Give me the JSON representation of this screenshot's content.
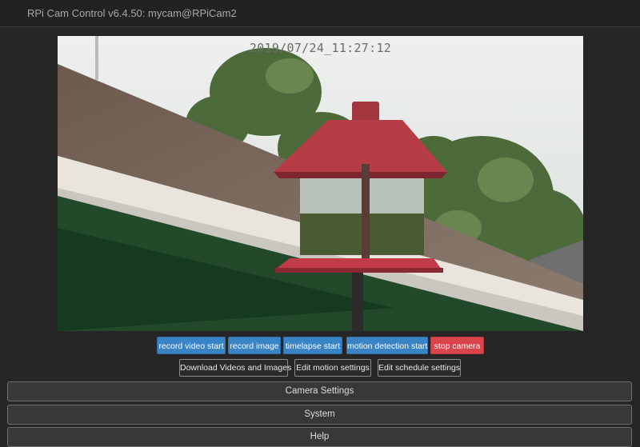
{
  "navbar": {
    "title": "RPi Cam Control v6.4.50: mycam@RPiCam2"
  },
  "preview": {
    "timestamp": "2019/07/24_11:27:12"
  },
  "controls": {
    "record_video": "record video start",
    "record_image": "record image",
    "timelapse": "timelapse start",
    "motion_detection": "motion detection start",
    "stop_camera": "stop camera"
  },
  "secondary": {
    "download": "Download Videos and Images",
    "edit_motion": "Edit motion settings",
    "edit_schedule": "Edit schedule settings"
  },
  "panels": {
    "camera_settings": "Camera Settings",
    "system": "System",
    "help": "Help"
  },
  "colors": {
    "primary_button": "#3a83c5",
    "danger_button": "#d9454a",
    "background": "#262626"
  }
}
